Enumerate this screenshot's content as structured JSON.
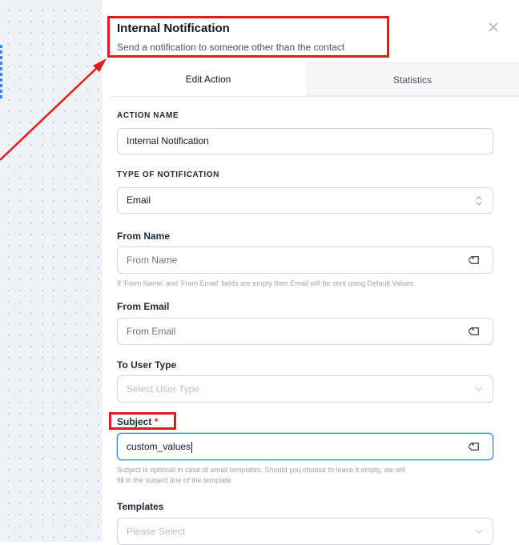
{
  "header": {
    "title": "Internal Notification",
    "subtitle": "Send a notification to someone other than the contact",
    "close_icon": "close-icon"
  },
  "tabs": [
    {
      "label": "Edit Action",
      "active": true
    },
    {
      "label": "Statistics",
      "active": false
    }
  ],
  "form": {
    "action_name": {
      "label": "ACTION NAME",
      "value": "Internal Notification"
    },
    "type_of_notification": {
      "label": "TYPE OF NOTIFICATION",
      "value": "Email",
      "icon": "chevron-updown-icon"
    },
    "from_name": {
      "label": "From Name",
      "placeholder": "From Name",
      "icon": "tag-icon",
      "helper": "If 'From Name' and 'From Email' fields are empty then Email will be sent using Default Values"
    },
    "from_email": {
      "label": "From Email",
      "placeholder": "From Email",
      "icon": "tag-icon"
    },
    "to_user_type": {
      "label": "To User Type",
      "placeholder": "Select User Type",
      "icon": "chevron-down-icon"
    },
    "subject": {
      "label": "Subject",
      "required_mark": "*",
      "value": "custom_values",
      "icon": "tag-icon",
      "helper_line1": "Subject is optional in case of email templates. Should you choose to leave it empty, we will",
      "helper_line2": "fill in the subject line of the template."
    },
    "templates": {
      "label": "Templates",
      "placeholder": "Please Select",
      "icon": "chevron-down-icon"
    }
  },
  "colors": {
    "annotation_red": "#e01b1b",
    "focus_blue": "#3b82f6"
  }
}
